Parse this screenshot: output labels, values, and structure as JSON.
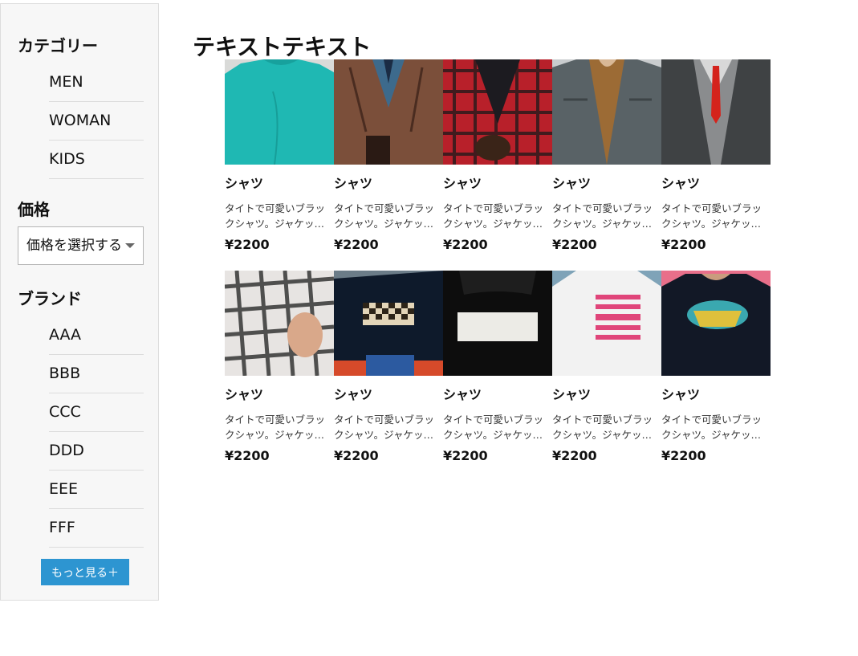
{
  "sidebar": {
    "category_title": "カテゴリー",
    "categories": [
      "MEN",
      "WOMAN",
      "KIDS"
    ],
    "price_title": "価格",
    "price_select_value": "価格を選択する",
    "brand_title": "ブランド",
    "brands": [
      "AAA",
      "BBB",
      "CCC",
      "DDD",
      "EEE",
      "FFF"
    ],
    "more_button": "もっと見る＋",
    "accent_color": "#2d95d1"
  },
  "main": {
    "title": "テキストテキスト",
    "products": [
      {
        "name": "シャツ",
        "desc": "タイトで可愛いブラックシャツ。ジャケットとの相性も抜群です。",
        "price": "¥2200",
        "image": "teal-longsleeve-shirt"
      },
      {
        "name": "シャツ",
        "desc": "タイトで可愛いブラックシャツ。ジャケットとの相性も抜群です。",
        "price": "¥2200",
        "image": "brown-leather-jacket"
      },
      {
        "name": "シャツ",
        "desc": "タイトで可愛いブラックシャツ。ジャケットとの相性も抜群です。",
        "price": "¥2200",
        "image": "red-plaid-shirt"
      },
      {
        "name": "シャツ",
        "desc": "タイトで可愛いブラックシャツ。ジャケットとの相性も抜群です。",
        "price": "¥2200",
        "image": "denim-jacket"
      },
      {
        "name": "シャツ",
        "desc": "タイトで可愛いブラックシャツ。ジャケットとの相性も抜群です。",
        "price": "¥2200",
        "image": "gray-vest-red-tie"
      },
      {
        "name": "シャツ",
        "desc": "タイトで可愛いブラックシャツ。ジャケットとの相性も抜群です。",
        "price": "¥2200",
        "image": "checked-shirt"
      },
      {
        "name": "シャツ",
        "desc": "タイトで可愛いブラックシャツ。ジャケットとの相性も抜群です。",
        "price": "¥2200",
        "image": "black-checker-tshirt"
      },
      {
        "name": "シャツ",
        "desc": "タイトで可愛いブラックシャツ。ジャケットとの相性も抜群です。",
        "price": "¥2200",
        "image": "black-white-stripe-sweater"
      },
      {
        "name": "シャツ",
        "desc": "タイトで可愛いブラックシャツ。ジャケットとの相性も抜群です。",
        "price": "¥2200",
        "image": "white-sound-guy-tshirt"
      },
      {
        "name": "シャツ",
        "desc": "タイトで可愛いブラックシャツ。ジャケットとの相性も抜群です。",
        "price": "¥2200",
        "image": "black-space-jam-tshirt"
      }
    ]
  }
}
